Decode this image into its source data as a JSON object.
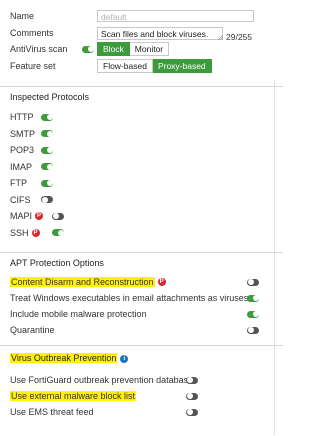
{
  "form": {
    "name_label": "Name",
    "name_placeholder": "default",
    "comments_label": "Comments",
    "comments_value": "Scan files and block viruses.",
    "comments_count": "29/255",
    "antivirus_label": "AntiVirus scan",
    "antivirus_options": [
      "Block",
      "Monitor"
    ],
    "antivirus_selected": "Block",
    "feature_label": "Feature set",
    "feature_options": [
      "Flow-based",
      "Proxy-based"
    ],
    "feature_selected": "Proxy-based"
  },
  "inspected": {
    "title": "Inspected Protocols",
    "items": [
      {
        "label": "HTTP",
        "badge": "",
        "on": true
      },
      {
        "label": "SMTP",
        "badge": "",
        "on": true
      },
      {
        "label": "POP3",
        "badge": "",
        "on": true
      },
      {
        "label": "IMAP",
        "badge": "",
        "on": true
      },
      {
        "label": "FTP",
        "badge": "",
        "on": true
      },
      {
        "label": "CIFS",
        "badge": "",
        "on": false
      },
      {
        "label": "MAPI",
        "badge": "P",
        "on": false
      },
      {
        "label": "SSH",
        "badge": "P",
        "on": true
      }
    ]
  },
  "apt": {
    "title": "APT Protection Options",
    "items": [
      {
        "label": "Content Disarm and Reconstruction",
        "badge": "P",
        "on": false,
        "highlight": true
      },
      {
        "label": "Treat Windows executables in email attachments as viruses",
        "badge": "",
        "on": true,
        "highlight": false
      },
      {
        "label": "Include mobile malware protection",
        "badge": "",
        "on": true,
        "highlight": false
      },
      {
        "label": "Quarantine",
        "badge": "",
        "on": false,
        "highlight": false
      }
    ]
  },
  "outbreak": {
    "title": "Virus Outbreak Prevention",
    "info_badge": "i",
    "items": [
      {
        "label": "Use FortiGuard outbreak prevention database",
        "on": false,
        "highlight": false
      },
      {
        "label": "Use external malware block list",
        "on": false,
        "highlight": true
      },
      {
        "label": "Use EMS threat feed",
        "on": false,
        "highlight": false
      }
    ]
  },
  "colors": {
    "accent_green": "#3d9a3d",
    "toggle_off": "#555555",
    "highlight": "#fff200",
    "premium_red": "#d9272e",
    "info_blue": "#1e73be"
  }
}
